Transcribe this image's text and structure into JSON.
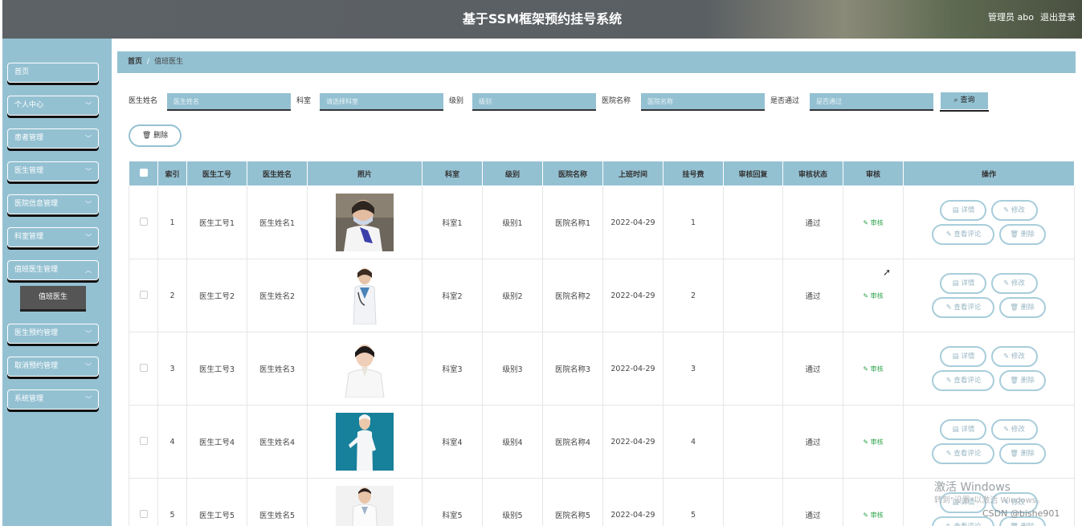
{
  "header": {
    "title": "基于SSM框架预约挂号系统",
    "user": "管理员 abo",
    "logout": "退出登录"
  },
  "sidebar": {
    "items": [
      {
        "label": "首页",
        "chev": false
      },
      {
        "label": "个人中心",
        "chev": true
      },
      {
        "label": "患者管理",
        "chev": true
      },
      {
        "label": "医生管理",
        "chev": true
      },
      {
        "label": "医院信息管理",
        "chev": true
      },
      {
        "label": "科室管理",
        "chev": true
      },
      {
        "label": "值班医生管理",
        "chev": true
      },
      {
        "label": "医生预约管理",
        "chev": true
      },
      {
        "label": "取消预约管理",
        "chev": true
      },
      {
        "label": "系统管理",
        "chev": true
      }
    ],
    "submenu": "值班医生"
  },
  "breadcrumb": {
    "home": "首页",
    "sep": "/",
    "current": "值班医生"
  },
  "filters": {
    "doctor_name": {
      "label": "医生姓名",
      "placeholder": "医生姓名"
    },
    "dept": {
      "label": "科室",
      "placeholder": "请选择科室"
    },
    "level": {
      "label": "级别",
      "placeholder": "级别"
    },
    "hospital": {
      "label": "医院名称",
      "placeholder": "医院名称"
    },
    "passed": {
      "label": "是否通过",
      "placeholder": "是否通过"
    },
    "search": "查询"
  },
  "delete_label": "删除",
  "columns": [
    "索引",
    "医生工号",
    "医生姓名",
    "照片",
    "科室",
    "级别",
    "医院名称",
    "上班时间",
    "挂号费",
    "审核回复",
    "审核状态",
    "审核",
    "操作"
  ],
  "rows": [
    {
      "index": "1",
      "no": "医生工号1",
      "name": "医生姓名1",
      "dept": "科室1",
      "level": "级别1",
      "hospital": "医院名称1",
      "time": "2022-04-29",
      "fee": "1",
      "reply": "",
      "status": "通过",
      "audit": "审核"
    },
    {
      "index": "2",
      "no": "医生工号2",
      "name": "医生姓名2",
      "dept": "科室2",
      "level": "级别2",
      "hospital": "医院名称2",
      "time": "2022-04-29",
      "fee": "2",
      "reply": "",
      "status": "通过",
      "audit": "审核"
    },
    {
      "index": "3",
      "no": "医生工号3",
      "name": "医生姓名3",
      "dept": "科室3",
      "level": "级别3",
      "hospital": "医院名称3",
      "time": "2022-04-29",
      "fee": "3",
      "reply": "",
      "status": "通过",
      "audit": "审核"
    },
    {
      "index": "4",
      "no": "医生工号4",
      "name": "医生姓名4",
      "dept": "科室4",
      "level": "级别4",
      "hospital": "医院名称4",
      "time": "2022-04-29",
      "fee": "4",
      "reply": "",
      "status": "通过",
      "audit": "审核"
    },
    {
      "index": "5",
      "no": "医生工号5",
      "name": "医生姓名5",
      "dept": "科室5",
      "level": "级别5",
      "hospital": "医院名称5",
      "time": "2022-04-29",
      "fee": "5",
      "reply": "",
      "status": "通过",
      "audit": "审核"
    }
  ],
  "actions": {
    "detail": "详情",
    "edit": "修改",
    "comments": "查看评论",
    "delete": "删除"
  },
  "watermark": {
    "line1": "激活 Windows",
    "line2": "转到\"设置\"以激活 Windows。",
    "csdn": "CSDN @bishe901"
  },
  "colors": {
    "accent": "#94c1d2",
    "header": "#5d6266",
    "audit_green": "#2ea34a"
  }
}
